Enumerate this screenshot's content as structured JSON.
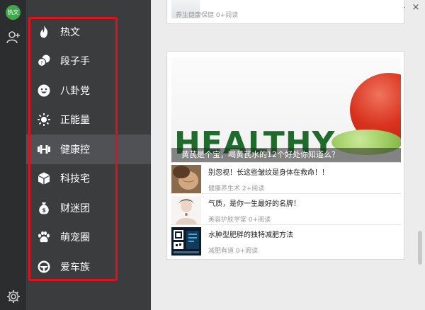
{
  "rail": {
    "logo_text": "热文",
    "add_icon": "user-plus-icon",
    "settings_icon": "gear-icon"
  },
  "sidebar": {
    "active_index": 4,
    "items": [
      {
        "label": "热文",
        "icon": "flame-icon"
      },
      {
        "label": "段子手",
        "icon": "chat-bubbles-icon"
      },
      {
        "label": "八卦党",
        "icon": "smiley-icon"
      },
      {
        "label": "正能量",
        "icon": "sun-icon"
      },
      {
        "label": "健康控",
        "icon": "dumbbell-icon"
      },
      {
        "label": "科技宅",
        "icon": "cube-icon"
      },
      {
        "label": "财迷团",
        "icon": "money-bag-icon"
      },
      {
        "label": "萌宠圈",
        "icon": "paw-icon"
      },
      {
        "label": "爱车族",
        "icon": "steering-wheel-icon"
      }
    ]
  },
  "window": {
    "minimize_label": "—",
    "close_label": "×"
  },
  "top_card": {
    "meta": "养生健康保健  0+阅读"
  },
  "feature": {
    "hero_word": "HEALTHY",
    "caption": "黄芪是个宝，喝黄芪水的12个好处你知道么？",
    "news": [
      {
        "title": "别忽视！长这些皱纹是身体在救命！！",
        "meta": "健康养生术  2+阅读"
      },
      {
        "title": "气质，是你一生最好的名牌！",
        "meta": "美容护肤学堂  0+阅读"
      },
      {
        "title": "水肿型肥胖的独特减肥方法",
        "meta": "减肥有道  0+阅读"
      }
    ]
  },
  "colors": {
    "highlight": "#e0101c",
    "rail_bg": "#2c2d2f",
    "sidebar_bg": "#3b3c3e",
    "active_bg": "#505154"
  }
}
